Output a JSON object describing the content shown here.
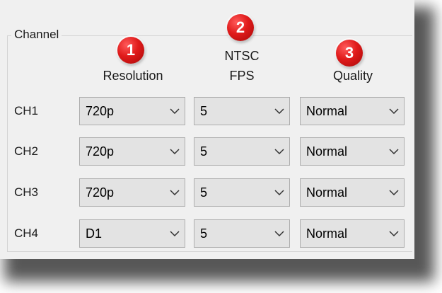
{
  "group_title": "Channel",
  "headers": {
    "resolution": "Resolution",
    "fps_line1": "NTSC",
    "fps_line2": "FPS",
    "quality": "Quality"
  },
  "badges": [
    "1",
    "2",
    "3"
  ],
  "channels": [
    {
      "label": "CH1",
      "resolution": "720p",
      "fps": "5",
      "quality": "Normal"
    },
    {
      "label": "CH2",
      "resolution": "720p",
      "fps": "5",
      "quality": "Normal"
    },
    {
      "label": "CH3",
      "resolution": "720p",
      "fps": "5",
      "quality": "Normal"
    },
    {
      "label": "CH4",
      "resolution": "D1",
      "fps": "5",
      "quality": "Normal"
    }
  ],
  "colors": {
    "badge": "#e01b1b",
    "panel_bg": "#f0f0f0",
    "dropdown_bg": "#e3e3e3"
  }
}
